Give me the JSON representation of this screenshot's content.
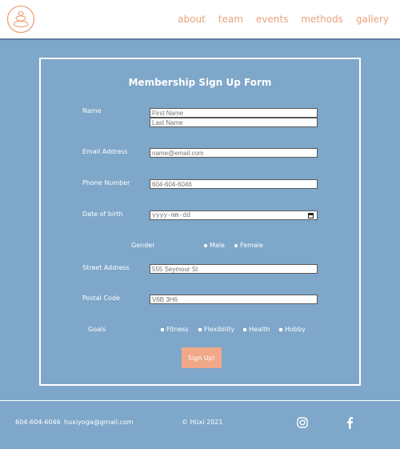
{
  "header": {
    "logo_icon": "stacked-stones-logo-icon",
    "nav": [
      {
        "label": "about"
      },
      {
        "label": "team"
      },
      {
        "label": "events"
      },
      {
        "label": "methods"
      },
      {
        "label": "gallery"
      }
    ]
  },
  "form": {
    "title": "Membership Sign Up Form",
    "name_label": "Name",
    "first_name": {
      "placeholder": "First Name"
    },
    "last_name": {
      "placeholder": "Last Name"
    },
    "email_label": "Email Address",
    "email": {
      "placeholder": "name@email.com"
    },
    "phone_label": "Phone Number",
    "phone": {
      "placeholder": "604-604-6046"
    },
    "dob_label": "Date of birth",
    "dob": {
      "placeholder": "yyyy-mm-dd"
    },
    "gender_label": "Gender",
    "gender_options": [
      {
        "label": "Male"
      },
      {
        "label": "Female"
      }
    ],
    "street_label": "Street Address",
    "street": {
      "placeholder": "555 Seymour St"
    },
    "postal_label": "Postal Code",
    "postal": {
      "placeholder": "V6B 3H6"
    },
    "goals_label": "Goals",
    "goal_options": [
      {
        "label": "Fitness"
      },
      {
        "label": "Flexibility"
      },
      {
        "label": "Health"
      },
      {
        "label": "Hobby"
      }
    ],
    "submit_label": "Sign Up!"
  },
  "footer": {
    "phone": "604-604-6046",
    "email": "huxiyoga@gmail.com",
    "copyright": "© Hüxí 2021",
    "icons": [
      "instagram-icon",
      "facebook-icon"
    ]
  },
  "colors": {
    "background": "#7ea7c9",
    "accent": "#e9a27a",
    "button": "#f0a888",
    "white": "#ffffff"
  }
}
